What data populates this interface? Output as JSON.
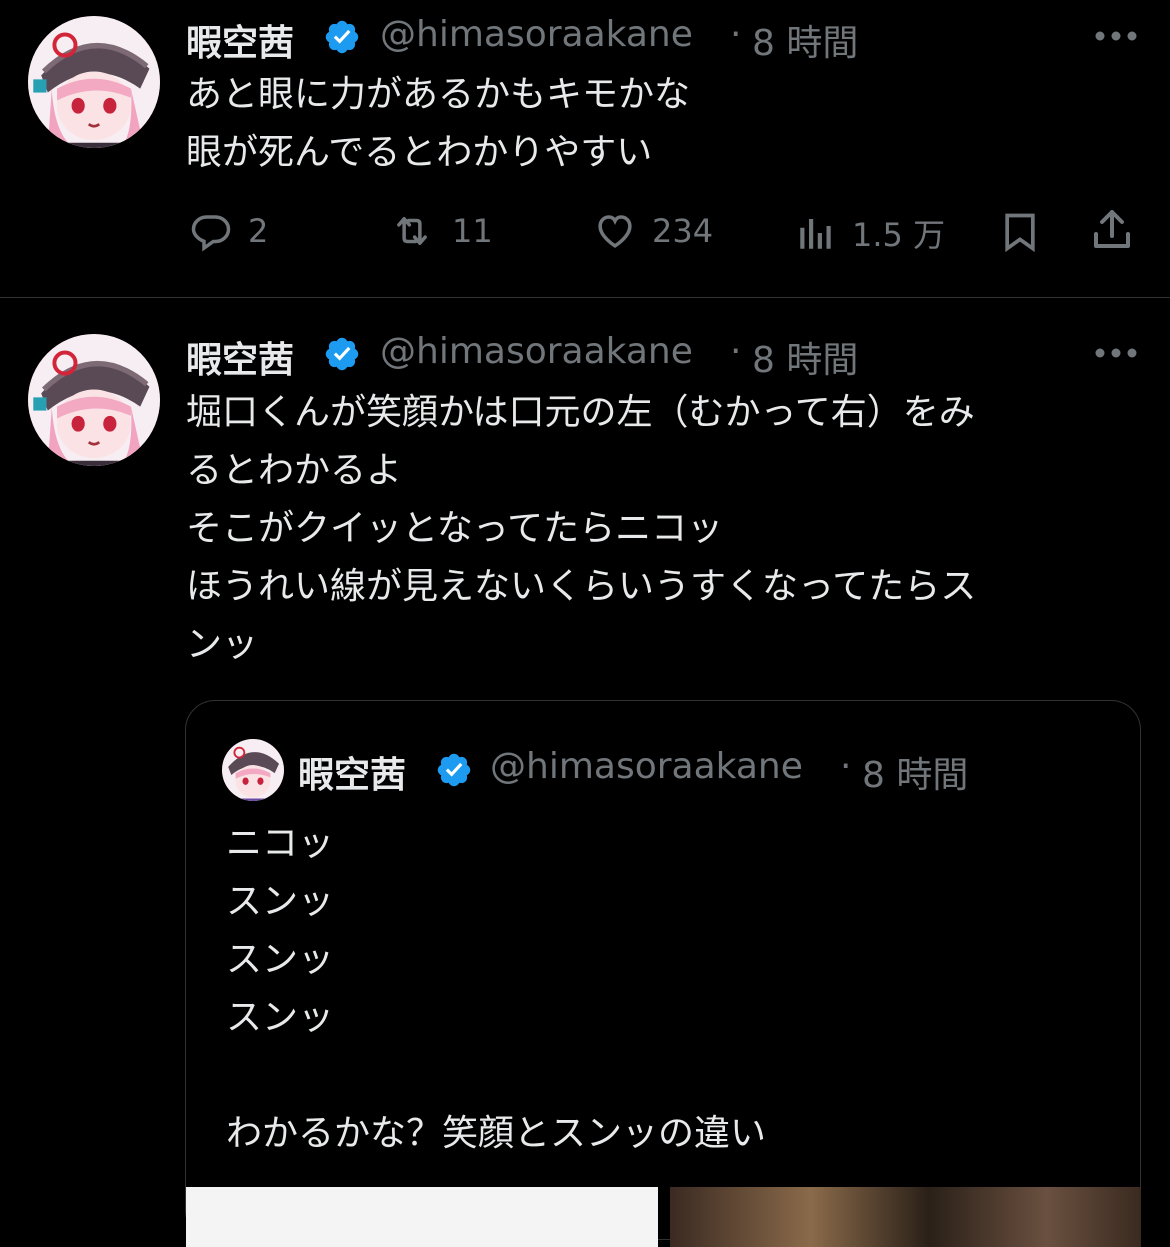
{
  "tweets": [
    {
      "name": "暇空茜",
      "handle": "@himasoraakane",
      "dot": "·",
      "time": "8 時間",
      "text": "あと眼に力があるかもキモかな\n眼が死んでるとわかりやすい",
      "metrics": {
        "replies": "2",
        "retweets": "11",
        "likes": "234",
        "views": "1.5 万"
      }
    },
    {
      "name": "暇空茜",
      "handle": "@himasoraakane",
      "dot": "·",
      "time": "8 時間",
      "text": "堀口くんが笑顔かは口元の左（むかって右）をみ\nるとわかるよ\nそこがクイッとなってたらニコッ\nほうれい線が見えないくらいうすくなってたらス\nンッ"
    }
  ],
  "quote": {
    "name": "暇空茜",
    "handle": "@himasoraakane",
    "dot": "·",
    "time": "8 時間",
    "text": "ニコッ\nスンッ\nスンッ\nスンッ\n\nわかるかな？笑顔とスンッの違い"
  },
  "colors": {
    "background": "#000000",
    "text": "#e7e9ea",
    "muted": "#71767b",
    "verified": "#1d9bf0",
    "border": "#2f3336"
  }
}
